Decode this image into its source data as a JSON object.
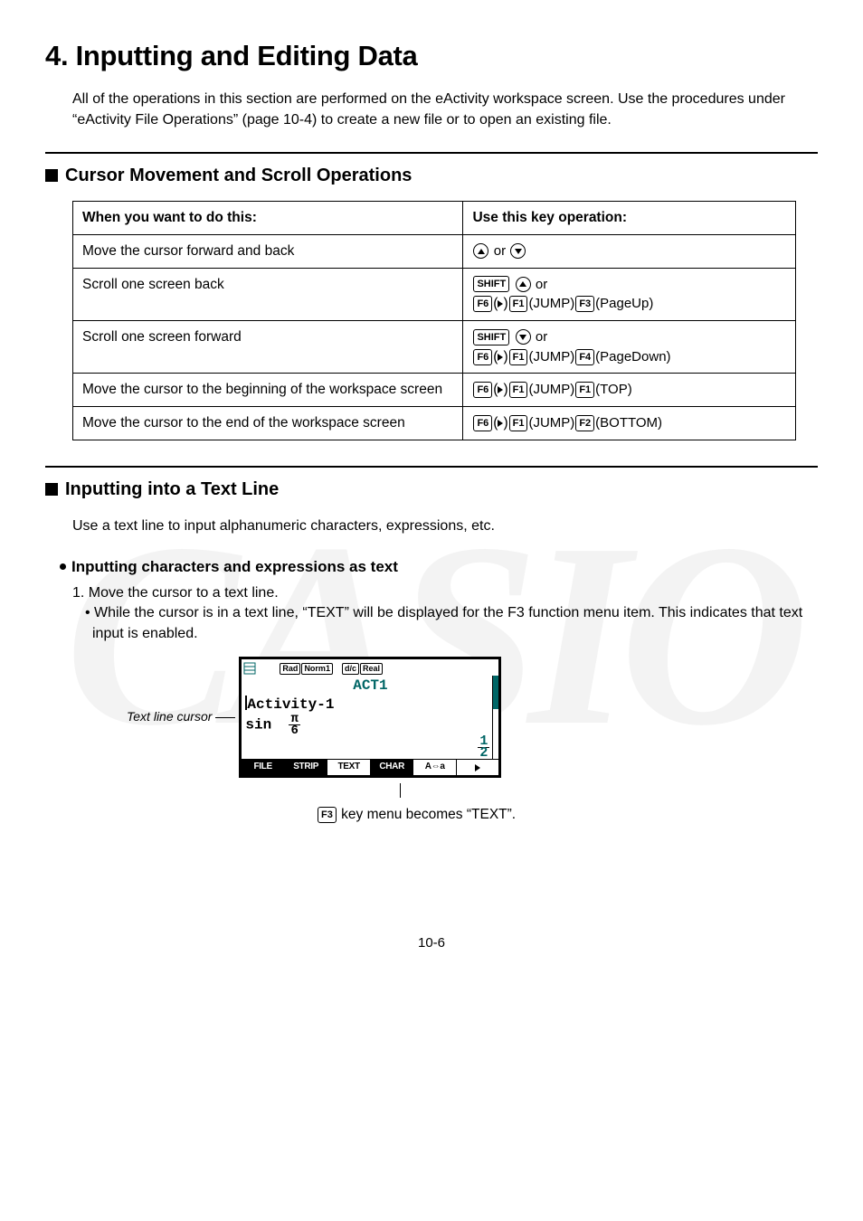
{
  "title": "4. Inputting and Editing Data",
  "intro": "All of the operations in this section are performed on the eActivity workspace screen. Use the procedures under “eActivity File Operations” (page 10-4) to create a new file or to open an existing file.",
  "section1": {
    "heading": "Cursor Movement and Scroll Operations",
    "table": {
      "col1": "When you want to do this:",
      "col2": "Use this key operation:",
      "rows": [
        {
          "desc": "Move the cursor forward and back",
          "op_text_mid": " or "
        },
        {
          "desc": "Scroll one screen back",
          "line1_tail": " or",
          "jump": "(JUMP)",
          "f3label": "(PageUp)"
        },
        {
          "desc": "Scroll one screen forward",
          "line1_tail": " or",
          "jump": "(JUMP)",
          "f4label": "(PageDown)"
        },
        {
          "desc": "Move the cursor to the beginning of the workspace screen",
          "jump": "(JUMP)",
          "toplabel": "(TOP)"
        },
        {
          "desc": "Move the cursor to the end of the workspace screen",
          "jump": "(JUMP)",
          "botlabel": "(BOTTOM)"
        }
      ]
    }
  },
  "section2": {
    "heading": "Inputting into a Text Line",
    "after": "Use a text line to input alphanumeric characters, expressions, etc.",
    "sub": "Inputting characters and expressions as text",
    "step1": "1. Move the cursor to a text line.",
    "bullet": "• While the cursor is in a text line, “TEXT” will be displayed for the F3 function menu item. This indicates that text input is enabled.",
    "figlabel": "Text line cursor",
    "screen": {
      "badges": [
        "Rad",
        "Norm1",
        "d/c",
        "Real"
      ],
      "titleline": "ACT1",
      "line1_pre": "Activity-1",
      "math_l": "sin",
      "frac_top": "π",
      "frac_bot": "6",
      "res_top": "1",
      "res_bot": "2",
      "fkeys": [
        "FILE",
        "STRIP",
        "TEXT",
        "CHAR",
        "A⇔a"
      ]
    },
    "annot_pre": " key menu becomes “TEXT”.",
    "annot_key": "F3"
  },
  "pagenum": "10-6",
  "keys": {
    "shift": "SHIFT",
    "f1": "F1",
    "f2": "F2",
    "f3": "F3",
    "f4": "F4",
    "f6": "F6"
  },
  "watermark": "CASIO"
}
